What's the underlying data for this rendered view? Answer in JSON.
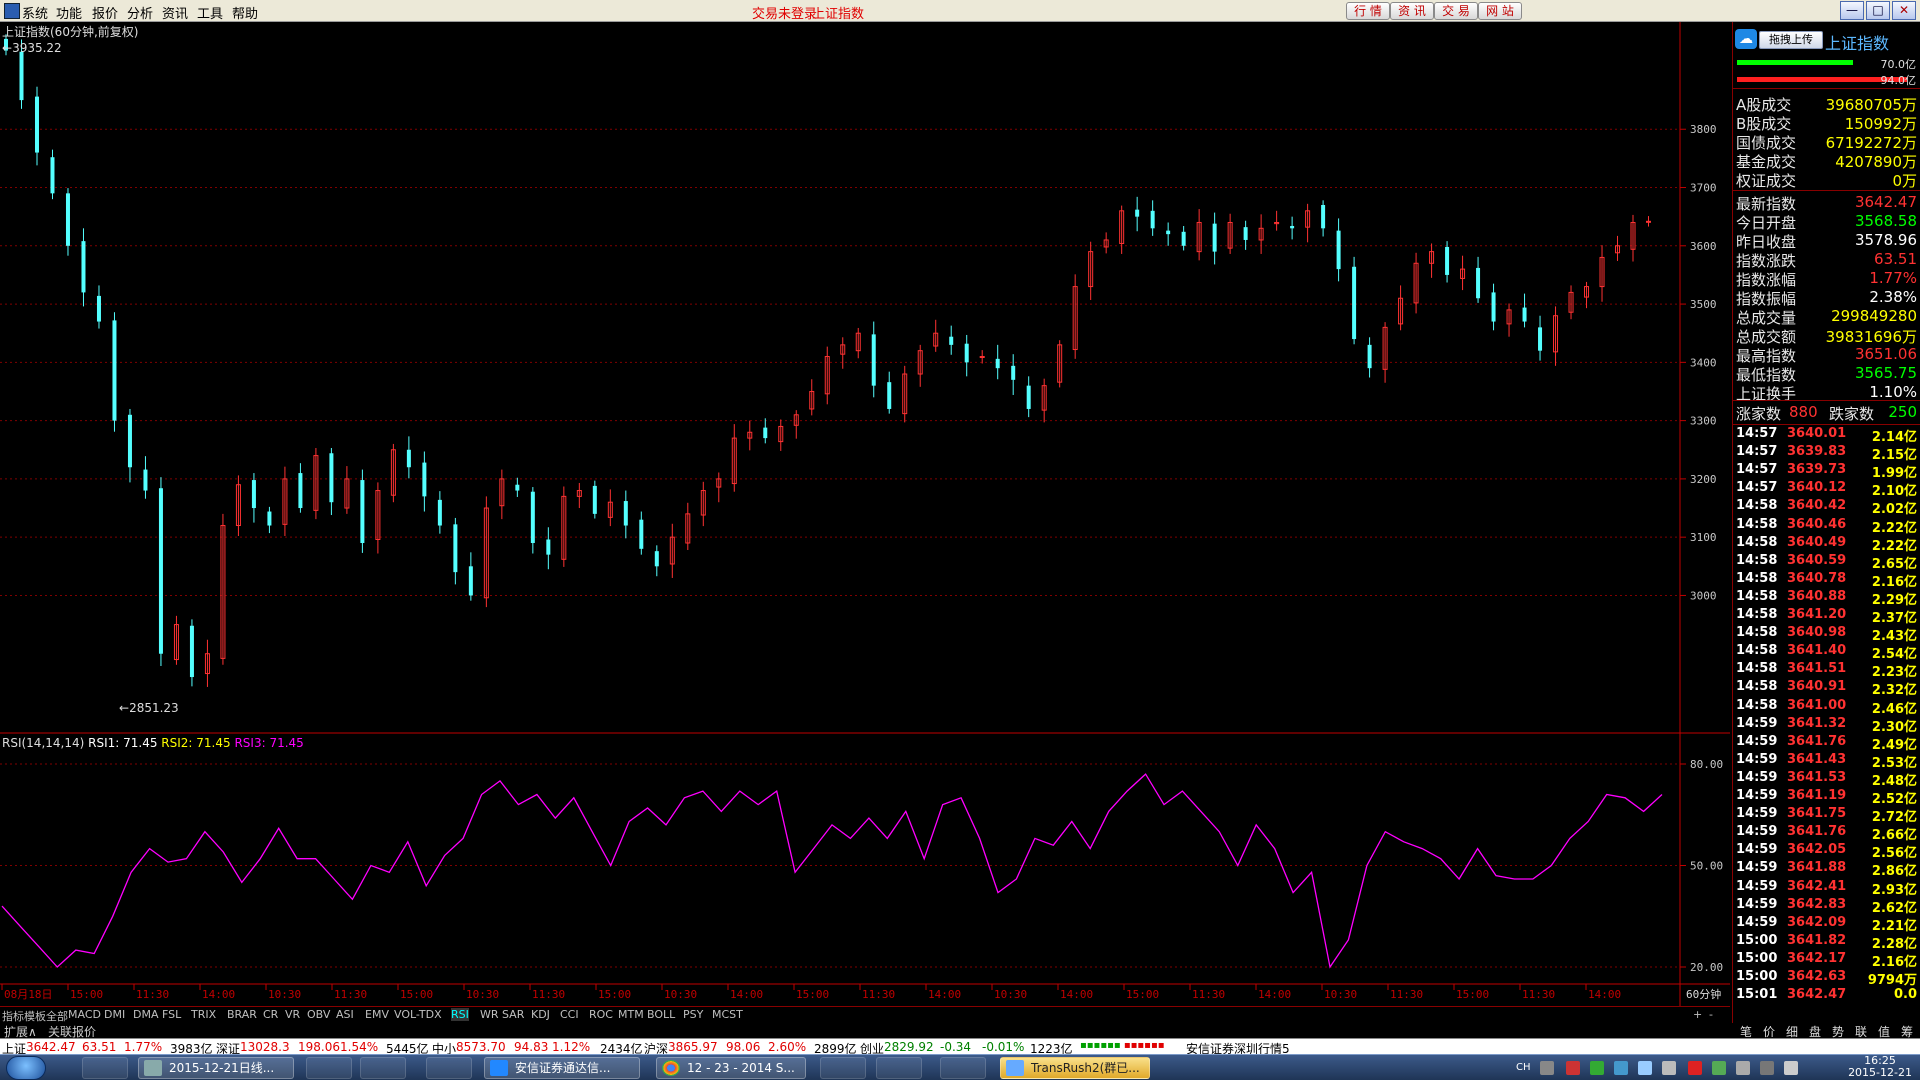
{
  "menu": {
    "items": [
      "系统",
      "功能",
      "报价",
      "分析",
      "资讯",
      "工具",
      "帮助"
    ],
    "trade_status": "交易未登录",
    "index_title": "上证指数",
    "buttons": [
      "行 情",
      "资 讯",
      "交 易",
      "网 站"
    ]
  },
  "chart": {
    "title": "上证指数(60分钟,前复权)",
    "high_label": "3935.22",
    "low_label": "2851.23",
    "price_axis": [
      "3800",
      "3700",
      "3600",
      "3500",
      "3400",
      "3300",
      "3200",
      "3100",
      "3000"
    ],
    "rsi_title": "RSI(14,14,14)",
    "rsi1_label": "RSI1: 71.45",
    "rsi2_label": "RSI2: 71.45",
    "rsi3_label": "RSI3: 71.45",
    "rsi_axis": [
      "80.00",
      "50.00",
      "20.00"
    ],
    "period": "60分钟",
    "time_labels": [
      "08月18日",
      "15:00",
      "11:30",
      "14:00",
      "10:30",
      "11:30",
      "15:00",
      "10:30",
      "11:30",
      "15:00",
      "10:30",
      "14:00",
      "15:00",
      "11:30",
      "14:00",
      "10:30",
      "14:00",
      "15:00",
      "11:30",
      "14:00",
      "10:30",
      "11:30",
      "15:00",
      "11:30",
      "14:00"
    ]
  },
  "chart_data": {
    "type": "candlestick",
    "title": "上证指数(60分钟,前复权)",
    "ylim": [
      2851.23,
      3935.22
    ],
    "annotations": {
      "high": 3935.22,
      "low": 2851.23
    },
    "close_series": [
      3935,
      3850,
      3760,
      3690,
      3600,
      3520,
      3470,
      3300,
      3220,
      3180,
      2900,
      2950,
      2860,
      2900,
      3120,
      3190,
      3150,
      3120,
      3200,
      3150,
      3240,
      3160,
      3200,
      3090,
      3180,
      3250,
      3220,
      3170,
      3120,
      3040,
      3000,
      3150,
      3200,
      3180,
      3090,
      3070,
      3170,
      3180,
      3140,
      3160,
      3120,
      3080,
      3050,
      3100,
      3140,
      3180,
      3200,
      3270,
      3280,
      3270,
      3290,
      3310,
      3350,
      3410,
      3430,
      3450,
      3360,
      3320,
      3380,
      3420,
      3450,
      3430,
      3400,
      3410,
      3390,
      3370,
      3320,
      3360,
      3430,
      3530,
      3590,
      3610,
      3660,
      3650,
      3630,
      3620,
      3600,
      3640,
      3590,
      3640,
      3610,
      3630,
      3640,
      3630,
      3660,
      3630,
      3560,
      3440,
      3390,
      3460,
      3510,
      3570,
      3590,
      3550,
      3560,
      3510,
      3470,
      3490,
      3470,
      3420,
      3480,
      3520,
      3530,
      3580,
      3600,
      3640,
      3642
    ],
    "rsi": {
      "name": "RSI1",
      "values": [
        38,
        32,
        26,
        20,
        25,
        24,
        35,
        48,
        55,
        51,
        52,
        60,
        54,
        45,
        52,
        61,
        52,
        52,
        46,
        40,
        50,
        48,
        57,
        44,
        53,
        58,
        71,
        75,
        68,
        71,
        64,
        70,
        60,
        50,
        63,
        67,
        62,
        70,
        72,
        66,
        72,
        68,
        72,
        48,
        55,
        62,
        58,
        64,
        58,
        66,
        52,
        68,
        70,
        58,
        42,
        46,
        58,
        56,
        63,
        55,
        66,
        72,
        77,
        68,
        72,
        66,
        60,
        50,
        62,
        55,
        42,
        48,
        20,
        28,
        50,
        60,
        57,
        55,
        52,
        46,
        55,
        47,
        46,
        46,
        50,
        58,
        63,
        71,
        70,
        66,
        71
      ]
    },
    "rsi_values_shown": {
      "RSI1": 71.45,
      "RSI2": 71.45,
      "RSI3": 71.45
    },
    "rsi_axis": [
      80,
      50,
      20
    ]
  },
  "market": {
    "upload_label": "拖拽上传",
    "index_name": "上证指数",
    "bar_values": [
      "70.0亿",
      "94.0亿"
    ],
    "turnover": [
      {
        "label": "A股成交",
        "value": "39680705万"
      },
      {
        "label": "B股成交",
        "value": "150992万"
      },
      {
        "label": "国债成交",
        "value": "67192272万"
      },
      {
        "label": "基金成交",
        "value": "4207890万"
      },
      {
        "label": "权证成交",
        "value": "0万"
      }
    ],
    "stats": [
      {
        "label": "最新指数",
        "value": "3642.47",
        "color": "red"
      },
      {
        "label": "今日开盘",
        "value": "3568.58",
        "color": "grn"
      },
      {
        "label": "昨日收盘",
        "value": "3578.96",
        "color": "wht"
      },
      {
        "label": "指数涨跌",
        "value": "63.51",
        "color": "red"
      },
      {
        "label": "指数涨幅",
        "value": "1.77%",
        "color": "red"
      },
      {
        "label": "指数振幅",
        "value": "2.38%",
        "color": "wht"
      },
      {
        "label": "总成交量",
        "value": "299849280",
        "color": "yel"
      },
      {
        "label": "总成交额",
        "value": "39831696万",
        "color": "yel"
      },
      {
        "label": "最高指数",
        "value": "3651.06",
        "color": "red"
      },
      {
        "label": "最低指数",
        "value": "3565.75",
        "color": "grn"
      },
      {
        "label": "上证换手",
        "value": "1.10%",
        "color": "wht"
      }
    ],
    "advance_label": "涨家数",
    "advance": "880",
    "decline_label": "跌家数",
    "decline": "250",
    "ticks": [
      [
        "14:57",
        "3640.01",
        "2.14亿"
      ],
      [
        "14:57",
        "3639.83",
        "2.15亿"
      ],
      [
        "14:57",
        "3639.73",
        "1.99亿"
      ],
      [
        "14:57",
        "3640.12",
        "2.10亿"
      ],
      [
        "14:58",
        "3640.42",
        "2.02亿"
      ],
      [
        "14:58",
        "3640.46",
        "2.22亿"
      ],
      [
        "14:58",
        "3640.49",
        "2.22亿"
      ],
      [
        "14:58",
        "3640.59",
        "2.65亿"
      ],
      [
        "14:58",
        "3640.78",
        "2.16亿"
      ],
      [
        "14:58",
        "3640.88",
        "2.29亿"
      ],
      [
        "14:58",
        "3641.20",
        "2.37亿"
      ],
      [
        "14:58",
        "3640.98",
        "2.43亿"
      ],
      [
        "14:58",
        "3641.40",
        "2.54亿"
      ],
      [
        "14:58",
        "3641.51",
        "2.23亿"
      ],
      [
        "14:58",
        "3640.91",
        "2.32亿"
      ],
      [
        "14:58",
        "3641.00",
        "2.46亿"
      ],
      [
        "14:59",
        "3641.32",
        "2.30亿"
      ],
      [
        "14:59",
        "3641.76",
        "2.49亿"
      ],
      [
        "14:59",
        "3641.43",
        "2.53亿"
      ],
      [
        "14:59",
        "3641.53",
        "2.48亿"
      ],
      [
        "14:59",
        "3641.19",
        "2.52亿"
      ],
      [
        "14:59",
        "3641.75",
        "2.72亿"
      ],
      [
        "14:59",
        "3641.76",
        "2.66亿"
      ],
      [
        "14:59",
        "3642.05",
        "2.56亿"
      ],
      [
        "14:59",
        "3641.88",
        "2.86亿"
      ],
      [
        "14:59",
        "3642.41",
        "2.93亿"
      ],
      [
        "14:59",
        "3642.83",
        "2.62亿"
      ],
      [
        "14:59",
        "3642.09",
        "2.21亿"
      ],
      [
        "15:00",
        "3641.82",
        "2.28亿"
      ],
      [
        "15:00",
        "3642.17",
        "2.16亿"
      ],
      [
        "15:00",
        "3642.63",
        "9794万"
      ],
      [
        "15:01",
        "3642.47",
        "0.0"
      ]
    ],
    "bottom_tabs": [
      "笔",
      "价",
      "细",
      "盘",
      "势",
      "联",
      "值",
      "筹"
    ]
  },
  "indicator_tabs": [
    "指标",
    "模板",
    "全部",
    "MACD",
    "DMI",
    "DMA",
    "FSL",
    "TRIX",
    "BRAR",
    "CR",
    "VR",
    "OBV",
    "ASI",
    "EMV",
    "VOL-TDX",
    "RSI",
    "WR",
    "SAR",
    "KDJ",
    "CCI",
    "ROC",
    "MTM",
    "BOLL",
    "PSY",
    "MCST"
  ],
  "active_indicator": "RSI",
  "ext": {
    "expand": "扩展∧",
    "quote": "关联报价"
  },
  "status": {
    "sh_label": "上证",
    "sh": "3642.47",
    "sh_chg": "63.51",
    "sh_pct": "1.77%",
    "sh_amt": "3983亿",
    "sz_label": "深证",
    "sz": "13028.3",
    "sz_chg": "198.06",
    "sz_pct": "1.54%",
    "sz_amt": "5445亿",
    "zx_label": "中小",
    "zx": "8573.70",
    "zx_chg": "94.83",
    "zx_pct": "1.12%",
    "zx_amt": "2434亿",
    "hs_label": "沪深",
    "hs": "3865.97",
    "hs_chg": "98.06",
    "hs_pct": "2.60%",
    "hs_amt": "2899亿",
    "cy_label": "创业",
    "cy": "2829.92",
    "cy_chg": "-0.34",
    "cy_pct": "-0.01%",
    "cy_amt": "1223亿",
    "server": "安信证券深圳行情5"
  },
  "taskbar": {
    "tasks": [
      "2015-12-21日线...",
      "安信证券通达信...",
      "12 - 23 - 2014 S...",
      "TransRush2(群已..."
    ],
    "time": "16:25",
    "date": "2015-12-21",
    "lang": "CH"
  },
  "colors": {
    "up": "#ff3232",
    "down": "#54ffff",
    "rsi": "#ff00ff",
    "grid": "#800000",
    "axis": "#c00000"
  }
}
